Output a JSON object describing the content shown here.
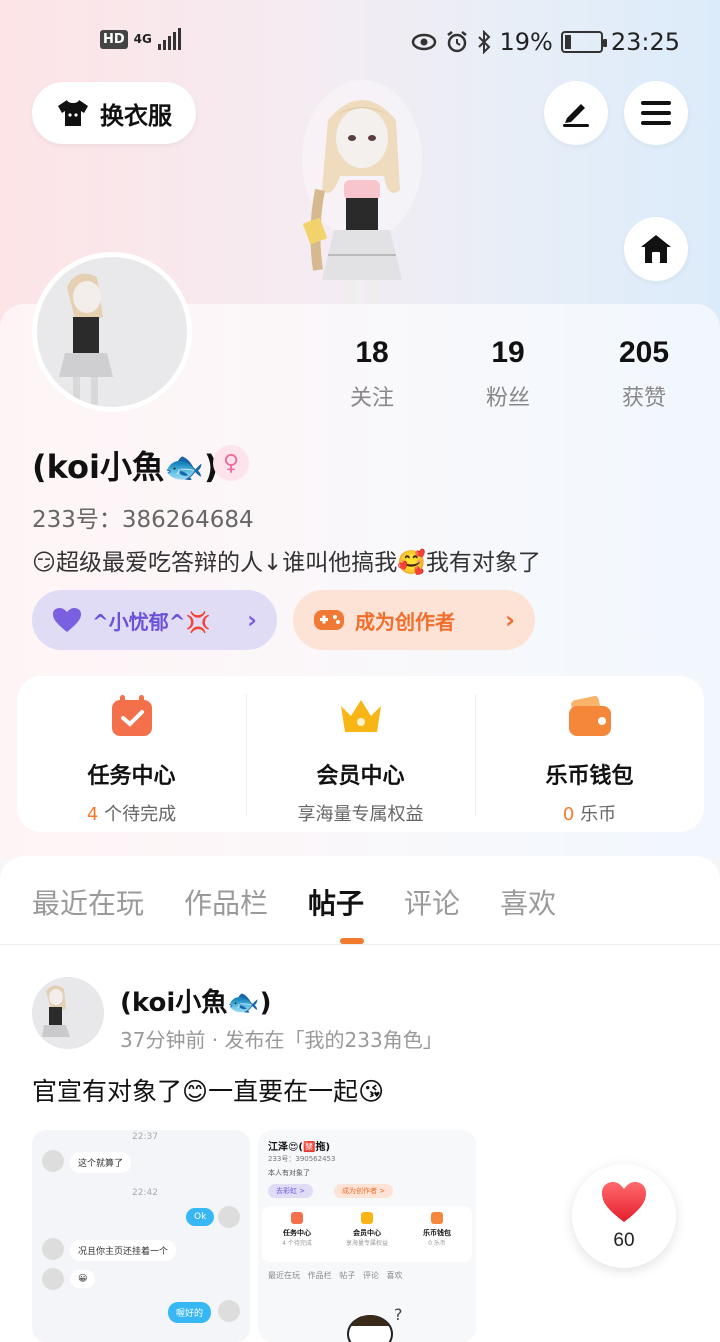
{
  "status": {
    "network_badge": "HD",
    "network_type": "4G",
    "battery_percent": "19%",
    "time": "23:25",
    "battery_level": 0.19
  },
  "header": {
    "wardrobe_label": "换衣服",
    "edit_icon": "pen-icon",
    "menu_icon": "hamburger-icon",
    "home_icon": "home-icon"
  },
  "stats": [
    {
      "value": "18",
      "label": "关注"
    },
    {
      "value": "19",
      "label": "粉丝"
    },
    {
      "value": "205",
      "label": "获赞"
    }
  ],
  "profile": {
    "username": "(koi小魚🐟)",
    "gender_symbol": "♀",
    "uid_line": "233号：386264684",
    "bio": "😏超级最爱吃答辩的人↓谁叫他搞我🥰我有对象了",
    "tag_purple": "^小忧郁^💢",
    "tag_orange": "成为创作者"
  },
  "menu": [
    {
      "title": "任务中心",
      "sub_prefix": "4",
      "sub_suffix": " 个待完成",
      "icon": "calendar-check-icon"
    },
    {
      "title": "会员中心",
      "sub_prefix": "",
      "sub_suffix": "享海量专属权益",
      "icon": "crown-icon"
    },
    {
      "title": "乐币钱包",
      "sub_prefix": "0",
      "sub_suffix": " 乐币",
      "icon": "wallet-icon"
    }
  ],
  "tabs": [
    "最近在玩",
    "作品栏",
    "帖子",
    "评论",
    "喜欢"
  ],
  "active_tab": 2,
  "post": {
    "username": "(koi小魚🐟)",
    "meta": "37分钟前 · 发布在「我的233角色」",
    "text": "官宣有对象了😊一直要在一起😘",
    "like_count": "60"
  },
  "shot1": {
    "time1": "22:37",
    "msg1": "这个就算了",
    "time2": "22:42",
    "msg2": "Ok",
    "msg3": "况且你主页还挂着一个",
    "msg4": "😀",
    "msg5": "喔好的"
  },
  "shot2": {
    "name": "江泽😍(🈲拖)",
    "uid": "233号：390562453",
    "bio": "本人有对象了",
    "tag1": "去彩虹 >",
    "tag2": "成为创作者 >",
    "m1": "任务中心",
    "m1s": "4 个待完成",
    "m2": "会员中心",
    "m2s": "享海量专属权益",
    "m3": "乐币钱包",
    "m3s": "0 乐币",
    "tabs": "最近在玩   作品栏   帖子   评论   喜欢"
  },
  "colors": {
    "accent": "#f27a2f",
    "purple": "#6c52d8",
    "chat_blue": "#37b8f4",
    "heart": "#f03b3b"
  }
}
